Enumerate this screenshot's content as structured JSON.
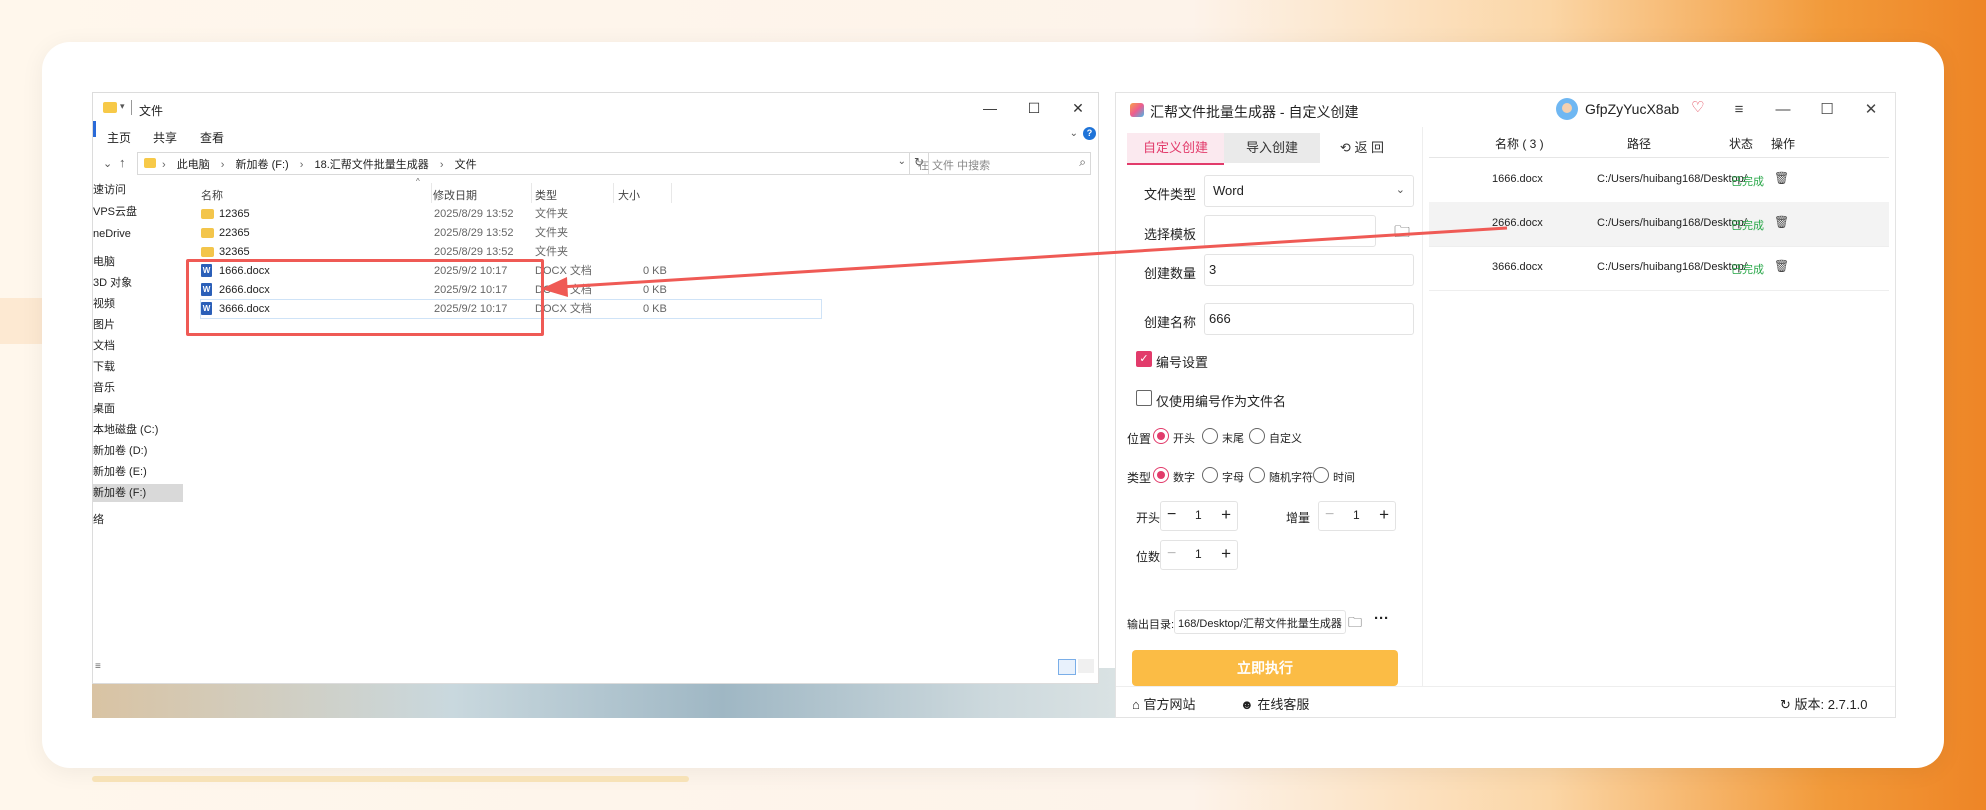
{
  "explorer": {
    "title": "文件",
    "ribbon": [
      "主页",
      "共享",
      "查看"
    ],
    "breadcrumbs": [
      "此电脑",
      "新加卷 (F:)",
      "18.汇帮文件批量生成器",
      "文件"
    ],
    "search_placeholder": "在 文件 中搜索",
    "sidebar": [
      "速访问",
      "VPS云盘",
      "neDrive",
      "电脑",
      "3D 对象",
      "视频",
      "图片",
      "文档",
      "下载",
      "音乐",
      "桌面",
      "本地磁盘 (C:)",
      "新加卷 (D:)",
      "新加卷 (E:)",
      "新加卷 (F:)",
      "络"
    ],
    "columns": {
      "name": "名称",
      "date": "修改日期",
      "type": "类型",
      "size": "大小"
    },
    "rows": [
      {
        "name": "12365",
        "date": "2025/8/29 13:52",
        "type": "文件夹",
        "size": ""
      },
      {
        "name": "22365",
        "date": "2025/8/29 13:52",
        "type": "文件夹",
        "size": ""
      },
      {
        "name": "32365",
        "date": "2025/8/29 13:52",
        "type": "文件夹",
        "size": ""
      },
      {
        "name": "1666.docx",
        "date": "2025/9/2 10:17",
        "type": "DOCX 文档",
        "size": "0 KB"
      },
      {
        "name": "2666.docx",
        "date": "2025/9/2 10:17",
        "type": "DOCX 文档",
        "size": "0 KB"
      },
      {
        "name": "3666.docx",
        "date": "2025/9/2 10:17",
        "type": "DOCX 文档",
        "size": "0 KB"
      }
    ]
  },
  "app": {
    "title": "汇帮文件批量生成器 - 自定义创建",
    "username": "GfpZyYucX8ab",
    "tabs": {
      "custom": "自定义创建",
      "import": "导入创建",
      "back": "返 回"
    },
    "fields": {
      "file_type_label": "文件类型",
      "file_type_value": "Word",
      "template_label": "选择模板",
      "template_value": "",
      "count_label": "创建数量",
      "count_value": "3",
      "name_label": "创建名称",
      "name_value": "666"
    },
    "numbering": {
      "label": "编号设置",
      "only_number_label": "仅使用编号作为文件名"
    },
    "position": {
      "label": "位置",
      "options": [
        "开头",
        "末尾",
        "自定义"
      ]
    },
    "kind": {
      "label": "类型",
      "options": [
        "数字",
        "字母",
        "随机字符",
        "时间"
      ]
    },
    "start": {
      "label": "开头",
      "value": "1"
    },
    "increment": {
      "label": "增量",
      "value": "1"
    },
    "digits": {
      "label": "位数",
      "value": "1"
    },
    "output": {
      "label": "输出目录:",
      "value": "168/Desktop/汇帮文件批量生成器"
    },
    "run_label": "立即执行",
    "footer": {
      "website": "官方网站",
      "support": "在线客服",
      "version": "版本: 2.7.1.0"
    },
    "table": {
      "headers": {
        "name": "名称 ( 3 )",
        "path": "路径",
        "status": "状态",
        "action": "操作"
      },
      "rows": [
        {
          "name": "1666.docx",
          "path": "C:/Users/huibang168/Desktop/",
          "status": "已完成"
        },
        {
          "name": "2666.docx",
          "path": "C:/Users/huibang168/Desktop/",
          "status": "已完成"
        },
        {
          "name": "3666.docx",
          "path": "C:/Users/huibang168/Desktop/",
          "status": "已完成"
        }
      ]
    }
  },
  "colors": {
    "accent": "#e23b6b",
    "run_button": "#fbbc45",
    "annotation": "#ef5a55",
    "status_ok": "#2aa84a"
  }
}
